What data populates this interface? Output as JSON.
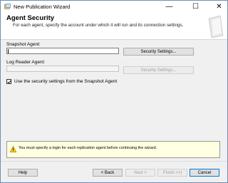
{
  "window": {
    "title": "New Publication Wizard",
    "controls": {
      "minimize": "—",
      "maximize": "☐",
      "close": "✕"
    }
  },
  "header": {
    "title": "Agent Security",
    "subtitle": "For each agent, specify the account under which it will run and its connection settings."
  },
  "snapshot_agent": {
    "label": "Snapshot Agent:",
    "value": "",
    "button": "Security Settings..."
  },
  "log_reader_agent": {
    "label": "Log Reader Agent:",
    "value": "",
    "button": "Security Settings..."
  },
  "use_snapshot_settings": {
    "label": "Use the security settings from the Snapshot Agent",
    "checked": true
  },
  "warning": {
    "text": "You must specify a login for each replication agent before continuing the wizard."
  },
  "footer": {
    "help": "Help",
    "back": "< Back",
    "next": "Next >",
    "finish": "Finish >>|",
    "cancel": "Cancel"
  },
  "colors": {
    "accent": "#0078d7",
    "warning_bg": "#ffffe1",
    "window_bg": "#f0f0f0"
  }
}
